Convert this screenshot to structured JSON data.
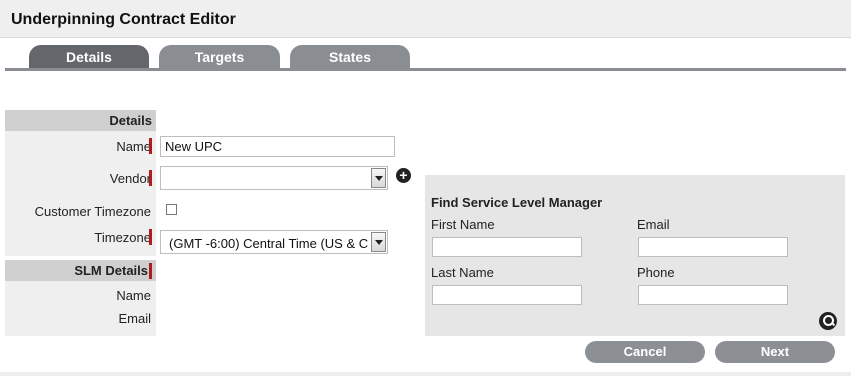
{
  "window": {
    "title": "Underpinning Contract Editor"
  },
  "tabs": [
    {
      "label": "Details",
      "active": true
    },
    {
      "label": "Targets",
      "active": false
    },
    {
      "label": "States",
      "active": false
    }
  ],
  "details": {
    "section_title": "Details",
    "name_label": "Name",
    "name_value": "New UPC",
    "vendor_label": "Vendor",
    "vendor_value": "",
    "customer_timezone_label": "Customer Timezone",
    "customer_timezone_checked": false,
    "timezone_label": "Timezone",
    "timezone_value": "(GMT -6:00) Central Time (US & C"
  },
  "slm_details": {
    "section_title": "SLM Details",
    "name_label": "Name",
    "email_label": "Email"
  },
  "find_slm": {
    "title": "Find Service Level Manager",
    "first_name_label": "First Name",
    "email_label": "Email",
    "last_name_label": "Last Name",
    "phone_label": "Phone",
    "first_name_value": "",
    "email_value": "",
    "last_name_value": "",
    "phone_value": ""
  },
  "buttons": {
    "cancel": "Cancel",
    "next": "Next"
  },
  "icons": {
    "add_vendor": "add-icon",
    "search": "search-icon"
  },
  "colors": {
    "tab_active": "#63676c",
    "tab_inactive": "#8a8e93",
    "required": "#b01c1c",
    "button": "#8c9095"
  }
}
